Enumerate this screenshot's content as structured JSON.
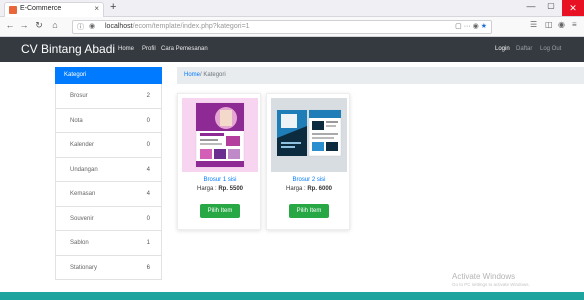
{
  "browser": {
    "tab_title": "E-Commerce",
    "tab_close": "×",
    "new_tab": "+",
    "url_host": "localhost",
    "url_path": "/ecom/template/index.php?kategori=1",
    "url_more": "···",
    "win_min": "—",
    "win_max": "▢",
    "win_close": "✕"
  },
  "site": {
    "brand": "CV Bintang Abadi",
    "nav": [
      "Home",
      "Profil",
      "Cara Pemesanan"
    ],
    "nav_right": [
      "Login",
      "Daftar",
      "Log Out"
    ]
  },
  "sidebar": {
    "heading": "Kategori",
    "items": [
      {
        "label": "Brosur",
        "count": "2"
      },
      {
        "label": "Nota",
        "count": "0"
      },
      {
        "label": "Kalender",
        "count": "0"
      },
      {
        "label": "Undangan",
        "count": "4"
      },
      {
        "label": "Kemasan",
        "count": "4"
      },
      {
        "label": "Souvenir",
        "count": "0"
      },
      {
        "label": "Sablon",
        "count": "1"
      },
      {
        "label": "Stationary",
        "count": "6"
      }
    ]
  },
  "breadcrumb": {
    "home": "Home",
    "sep": "/",
    "current": "Kategori"
  },
  "products": [
    {
      "name": "Brosur 1 sisi",
      "price_label": "Harga : ",
      "price": "Rp. 5500",
      "button": "Pilih Item"
    },
    {
      "name": "Brosur 2 sisi",
      "price_label": "Harga : ",
      "price": "Rp. 6000",
      "button": "Pilih Item"
    }
  ],
  "watermark": {
    "title": "Activate Windows",
    "subtitle": "Go to PC settings to activate Windows."
  },
  "colors": {
    "header_bg": "#343a40",
    "primary": "#007bff",
    "success": "#28a745",
    "footer": "#1fa39e"
  }
}
